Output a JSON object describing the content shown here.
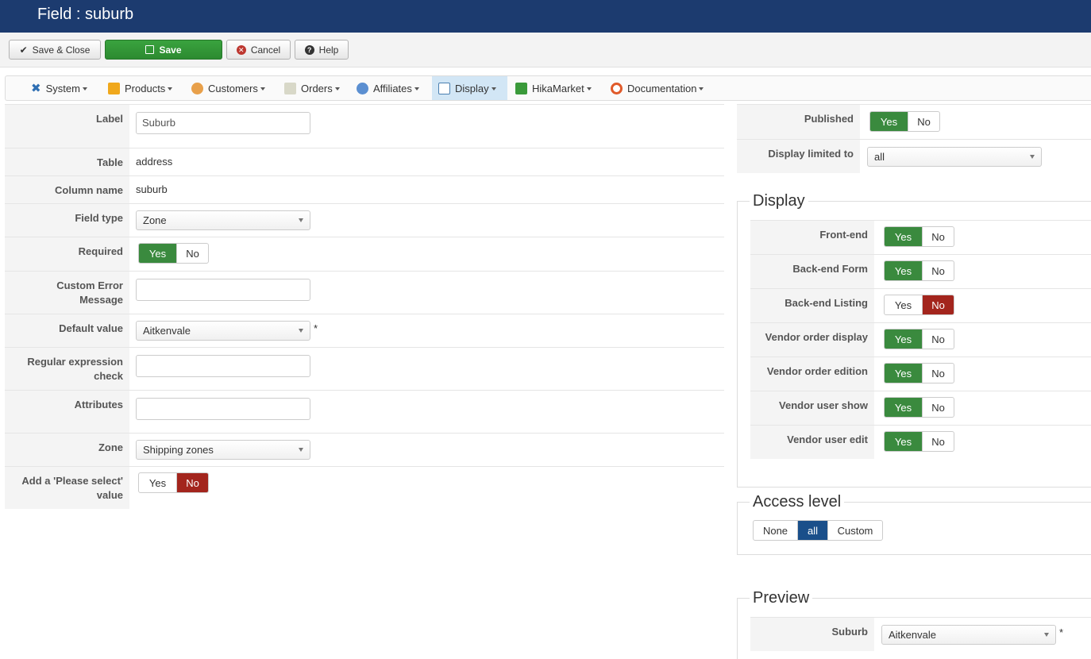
{
  "title": "Field : suburb",
  "toolbar": {
    "save_close": "Save & Close",
    "save": "Save",
    "cancel": "Cancel",
    "help": "Help"
  },
  "menu": {
    "items": [
      "System",
      "Products",
      "Customers",
      "Orders",
      "Affiliates",
      "Display",
      "HikaMarket",
      "Documentation"
    ],
    "active": "Display"
  },
  "form": {
    "label": {
      "label": "Label",
      "value": "Suburb"
    },
    "table": {
      "label": "Table",
      "value": "address"
    },
    "column_name": {
      "label": "Column name",
      "value": "suburb"
    },
    "field_type": {
      "label": "Field type",
      "value": "Zone"
    },
    "required": {
      "label": "Required",
      "yes": "Yes",
      "no": "No",
      "selected": "Yes"
    },
    "custom_error": {
      "label": "Custom Error Message",
      "value": ""
    },
    "default_value": {
      "label": "Default value",
      "value": "Aitkenvale",
      "marker": "*"
    },
    "regex": {
      "label": "Regular expression check",
      "value": ""
    },
    "attributes": {
      "label": "Attributes",
      "value": ""
    },
    "zone": {
      "label": "Zone",
      "value": "Shipping zones"
    },
    "please_select": {
      "label": "Add a 'Please select' value",
      "yes": "Yes",
      "no": "No",
      "selected": "No"
    }
  },
  "side": {
    "published": {
      "label": "Published",
      "yes": "Yes",
      "no": "No",
      "selected": "Yes"
    },
    "display_limited": {
      "label": "Display limited to",
      "value": "all"
    }
  },
  "display": {
    "legend": "Display",
    "rows": [
      {
        "label": "Front-end",
        "yes": "Yes",
        "no": "No",
        "selected": "Yes"
      },
      {
        "label": "Back-end Form",
        "yes": "Yes",
        "no": "No",
        "selected": "Yes"
      },
      {
        "label": "Back-end Listing",
        "yes": "Yes",
        "no": "No",
        "selected": "No"
      },
      {
        "label": "Vendor order display",
        "yes": "Yes",
        "no": "No",
        "selected": "Yes"
      },
      {
        "label": "Vendor order edition",
        "yes": "Yes",
        "no": "No",
        "selected": "Yes"
      },
      {
        "label": "Vendor user show",
        "yes": "Yes",
        "no": "No",
        "selected": "Yes"
      },
      {
        "label": "Vendor user edit",
        "yes": "Yes",
        "no": "No",
        "selected": "Yes"
      }
    ]
  },
  "access": {
    "legend": "Access level",
    "options": [
      "None",
      "all",
      "Custom"
    ],
    "selected": "all"
  },
  "preview": {
    "legend": "Preview",
    "label": "Suburb",
    "value": "Aitkenvale",
    "marker": "*"
  },
  "colors": {
    "header": "#1c3b6f",
    "green": "#3a8a3e",
    "red": "#a3251d",
    "blue": "#1a4f8a"
  }
}
